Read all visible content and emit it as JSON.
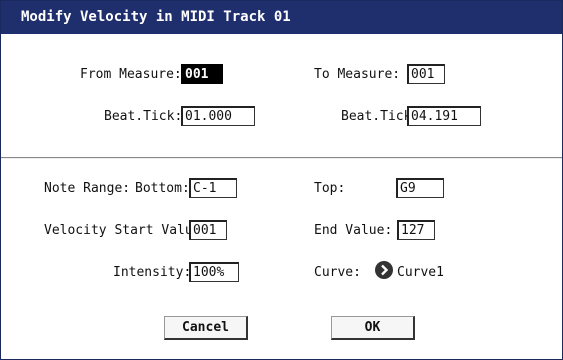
{
  "dialog": {
    "title": "Modify Velocity in MIDI Track 01"
  },
  "range": {
    "from_measure_label": "From Measure:",
    "from_measure_value": "001",
    "to_measure_label": "To Measure:",
    "to_measure_value": "001",
    "from_beat_label": "Beat.Tick:",
    "from_beat_value": "01.000",
    "to_beat_label": "Beat.Tick:",
    "to_beat_value": "04.191"
  },
  "params": {
    "note_range_label": "Note Range:",
    "bottom_label": "Bottom:",
    "bottom_value": "C-1",
    "top_label": "Top:",
    "top_value": "G9",
    "velocity_start_label": "Velocity Start Value:",
    "velocity_start_value": "001",
    "end_value_label": "End Value:",
    "end_value_value": "127",
    "intensity_label": "Intensity:",
    "intensity_value": "100%",
    "curve_label": "Curve:",
    "curve_value": "Curve1"
  },
  "buttons": {
    "cancel": "Cancel",
    "ok": "OK"
  },
  "colors": {
    "titlebar": "#1f2f6e",
    "selected_field": "#000000",
    "curve_icon": "#333333"
  }
}
